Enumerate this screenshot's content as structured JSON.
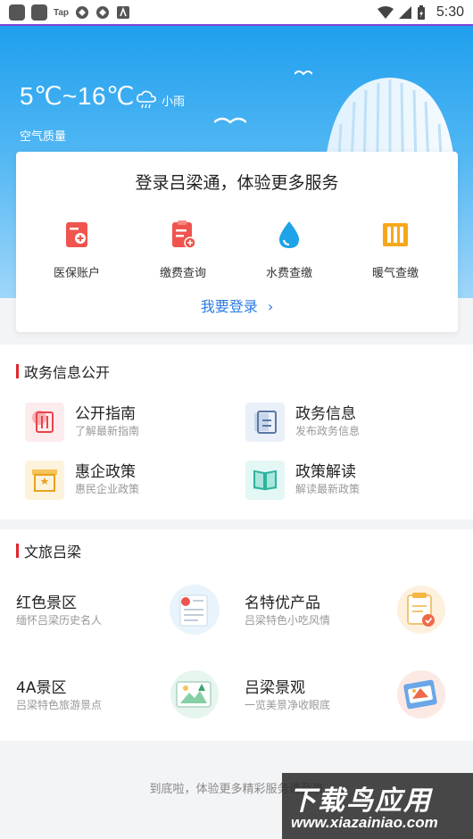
{
  "status_bar": {
    "tap_label": "Tap",
    "time": "5:30"
  },
  "weather": {
    "temperature": "5℃~16℃",
    "description": "小雨",
    "air_quality_label": "空气质量"
  },
  "login_card": {
    "title": "登录吕梁通，体验更多服务",
    "services": [
      {
        "label": "医保账户",
        "icon": "medical-insurance-icon",
        "color": "#f0544f"
      },
      {
        "label": "缴费查询",
        "icon": "bill-query-icon",
        "color": "#f0544f"
      },
      {
        "label": "水费查缴",
        "icon": "water-drop-icon",
        "color": "#1ea3e9"
      },
      {
        "label": "暖气查缴",
        "icon": "radiator-icon",
        "color": "#f7a81a"
      }
    ],
    "login_link": "我要登录",
    "login_chevron": "›"
  },
  "gov_section": {
    "title": "政务信息公开",
    "items": [
      {
        "title": "公开指南",
        "subtitle": "了解最新指南",
        "icon": "guide-book-icon"
      },
      {
        "title": "政务信息",
        "subtitle": "发布政务信息",
        "icon": "document-icon"
      },
      {
        "title": "惠企政策",
        "subtitle": "惠民企业政策",
        "icon": "policy-box-icon"
      },
      {
        "title": "政策解读",
        "subtitle": "解读最新政策",
        "icon": "open-book-icon"
      }
    ]
  },
  "culture_section": {
    "title": "文旅吕梁",
    "items": [
      {
        "title": "红色景区",
        "subtitle": "缅怀吕梁历史名人",
        "icon": "red-scenic-icon"
      },
      {
        "title": "名特优产品",
        "subtitle": "吕梁特色小吃风情",
        "icon": "specialty-product-icon"
      },
      {
        "title": "4A景区",
        "subtitle": "吕梁特色旅游景点",
        "icon": "landscape-card-icon"
      },
      {
        "title": "吕梁景观",
        "subtitle": "一览美景净收眼底",
        "icon": "landmark-icon"
      }
    ]
  },
  "footer": {
    "text": "到底啦，体验更多精彩服务请登录"
  },
  "watermark": {
    "line1": "下载鸟应用",
    "line2": "www.xiazainiao.com"
  }
}
